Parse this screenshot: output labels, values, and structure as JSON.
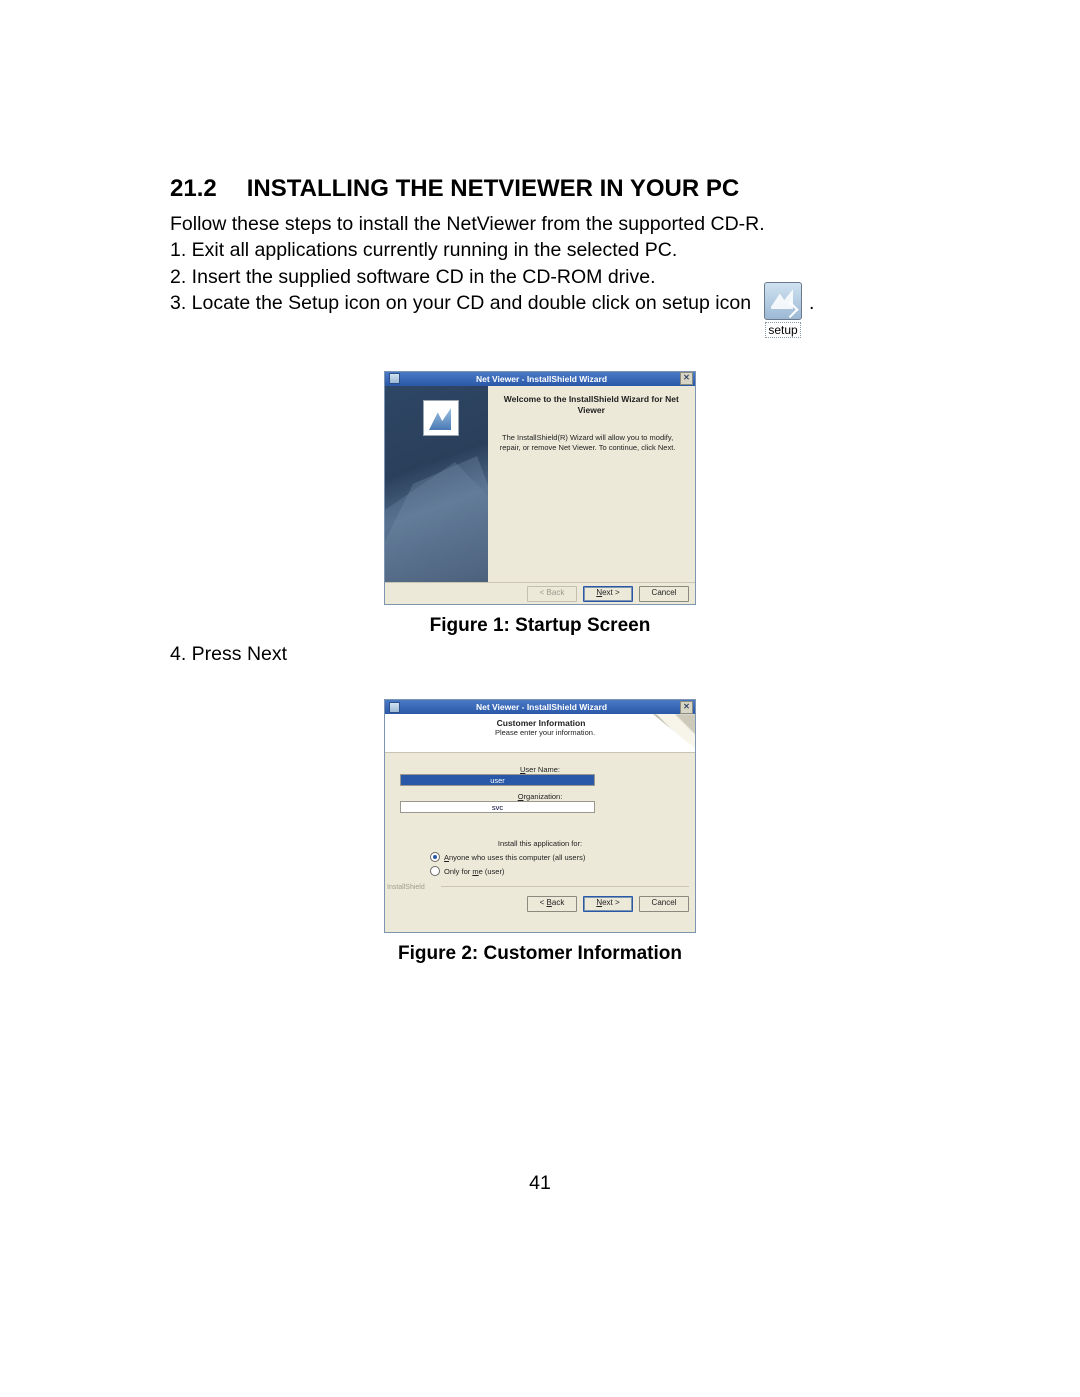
{
  "heading": {
    "number": "21.2",
    "title": "INSTALLING THE NETVIEWER IN YOUR PC"
  },
  "intro": "Follow these steps to install the NetViewer from the supported CD-R.",
  "steps": {
    "1": "1. Exit all applications currently running in the selected PC.",
    "2": "2. Insert the supplied software CD in the CD-ROM drive.",
    "3": "3. Locate the Setup icon on your CD and double click on setup icon",
    "3_trailer": ".",
    "4": "4. Press Next"
  },
  "setup_icon_caption": "setup",
  "figure1": {
    "caption": "Figure 1: Startup Screen",
    "window_title": "Net Viewer - InstallShield Wizard",
    "welcome": "Welcome to the InstallShield Wizard for Net Viewer",
    "desc": "The InstallShield(R) Wizard will allow you to modify, repair, or remove Net Viewer. To continue, click Next.",
    "buttons": {
      "back": "< Back",
      "next_prefix": "N",
      "next_rest": "ext >",
      "cancel": "Cancel"
    }
  },
  "figure2": {
    "caption": "Figure 2: Customer Information",
    "window_title": "Net Viewer - InstallShield Wizard",
    "header_title": "Customer Information",
    "header_sub": "Please enter your information.",
    "fields": {
      "username_label_prefix": "U",
      "username_label_rest": "ser Name:",
      "username_value": "user",
      "org_label_prefix": "O",
      "org_label_rest": "rganization:",
      "org_value": "svc"
    },
    "install_for": "Install this application for:",
    "radio_all_prefix": "A",
    "radio_all_rest": "nyone who uses this computer (all users)",
    "radio_me_a": "Only for ",
    "radio_me_u": "m",
    "radio_me_b": "e (user)",
    "watermark": "InstallShield",
    "buttons": {
      "back_prefix": "B",
      "back_rest": "ack",
      "next_prefix": "N",
      "next_rest": "ext >",
      "cancel": "Cancel"
    }
  },
  "page_number": "41"
}
